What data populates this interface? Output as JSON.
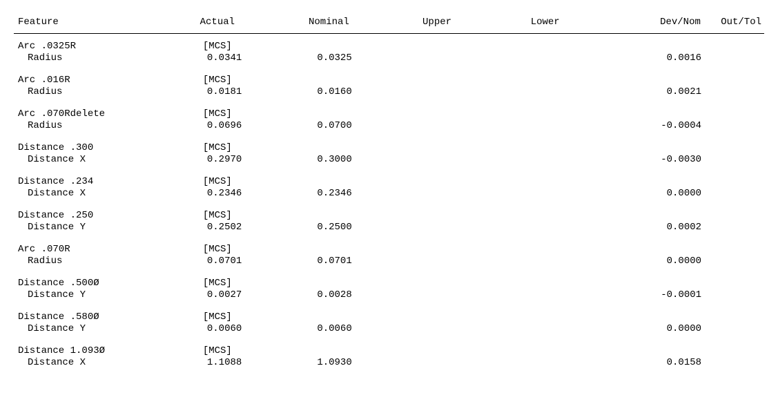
{
  "headers": {
    "feature": "Feature",
    "actual": "Actual",
    "nominal": "Nominal",
    "upper": "Upper",
    "lower": "Lower",
    "devnom": "Dev/Nom",
    "outtol": "Out/Tol"
  },
  "rows": [
    {
      "feature": "Arc .0325R",
      "cs": "[MCS]",
      "param": "Radius",
      "actual": "0.0341",
      "nominal": "0.0325",
      "upper": "",
      "lower": "",
      "devnom": "0.0016",
      "outtol": ""
    },
    {
      "feature": "Arc .016R",
      "cs": "[MCS]",
      "param": "Radius",
      "actual": "0.0181",
      "nominal": "0.0160",
      "upper": "",
      "lower": "",
      "devnom": "0.0021",
      "outtol": ""
    },
    {
      "feature": "Arc .070Rdelete",
      "cs": "[MCS]",
      "param": "Radius",
      "actual": "0.0696",
      "nominal": "0.0700",
      "upper": "",
      "lower": "",
      "devnom": "-0.0004",
      "outtol": ""
    },
    {
      "feature": "Distance .300",
      "cs": "[MCS]",
      "param": "Distance X",
      "actual": "0.2970",
      "nominal": "0.3000",
      "upper": "",
      "lower": "",
      "devnom": "-0.0030",
      "outtol": ""
    },
    {
      "feature": "Distance .234",
      "cs": "[MCS]",
      "param": "Distance X",
      "actual": "0.2346",
      "nominal": "0.2346",
      "upper": "",
      "lower": "",
      "devnom": "0.0000",
      "outtol": ""
    },
    {
      "feature": "Distance .250",
      "cs": "[MCS]",
      "param": "Distance Y",
      "actual": "0.2502",
      "nominal": "0.2500",
      "upper": "",
      "lower": "",
      "devnom": "0.0002",
      "outtol": ""
    },
    {
      "feature": "Arc .070R",
      "cs": "[MCS]",
      "param": "Radius",
      "actual": "0.0701",
      "nominal": "0.0701",
      "upper": "",
      "lower": "",
      "devnom": "0.0000",
      "outtol": ""
    },
    {
      "feature": "Distance .500Ø",
      "cs": "[MCS]",
      "param": "Distance Y",
      "actual": "0.0027",
      "nominal": "0.0028",
      "upper": "",
      "lower": "",
      "devnom": "-0.0001",
      "outtol": ""
    },
    {
      "feature": "Distance .580Ø",
      "cs": "[MCS]",
      "param": "Distance Y",
      "actual": "0.0060",
      "nominal": "0.0060",
      "upper": "",
      "lower": "",
      "devnom": "0.0000",
      "outtol": ""
    },
    {
      "feature": "Distance 1.093Ø",
      "cs": "[MCS]",
      "param": "Distance X",
      "actual": "1.1088",
      "nominal": "1.0930",
      "upper": "",
      "lower": "",
      "devnom": "0.0158",
      "outtol": ""
    }
  ]
}
